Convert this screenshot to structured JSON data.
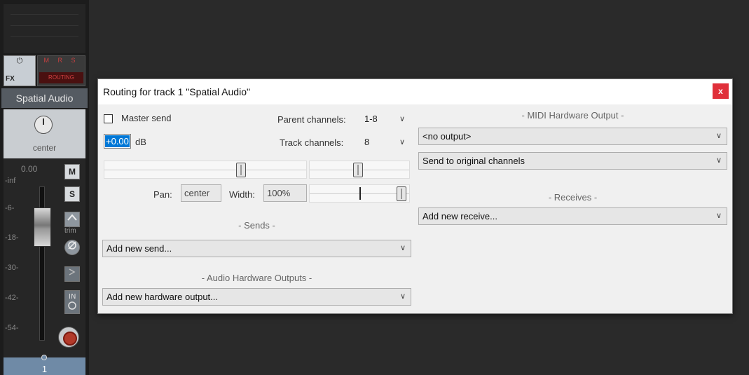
{
  "mixer": {
    "power_glyph": "⏻",
    "fx_label": "FX",
    "mrs_label": "M R S",
    "routing_label": "ROUTING",
    "track_name": "Spatial Audio",
    "pan_label": "center",
    "volume_readout": "0.00",
    "meter_ticks": [
      "-inf",
      "-6-",
      "-18-",
      "-30-",
      "-42-",
      "-54-"
    ],
    "mute_label": "M",
    "solo_label": "S",
    "trim_label": "trim",
    "track_number": "1"
  },
  "dialog": {
    "title": "Routing for track 1 \"Spatial Audio\"",
    "close_label": "x",
    "master_send": {
      "label": "Master send",
      "checked": false
    },
    "parent_channels": {
      "label": "Parent channels:",
      "value": "1-8"
    },
    "track_channels": {
      "label": "Track channels:",
      "value": "8"
    },
    "volume": {
      "value": "+0.00",
      "unit": "dB"
    },
    "pan": {
      "label": "Pan:",
      "value": "center"
    },
    "width": {
      "label": "Width:",
      "value": "100%"
    },
    "sends": {
      "header": "- Sends -",
      "dropdown": "Add new send..."
    },
    "audio_hw_outputs": {
      "header": "- Audio Hardware Outputs -",
      "dropdown": "Add new hardware output..."
    },
    "midi_hw_output": {
      "header": "- MIDI Hardware Output -",
      "output": "<no output>",
      "channels": "Send to original channels"
    },
    "receives": {
      "header": "- Receives -",
      "dropdown": "Add new receive..."
    }
  },
  "icons": {
    "dropdown_chevron": "∨"
  }
}
